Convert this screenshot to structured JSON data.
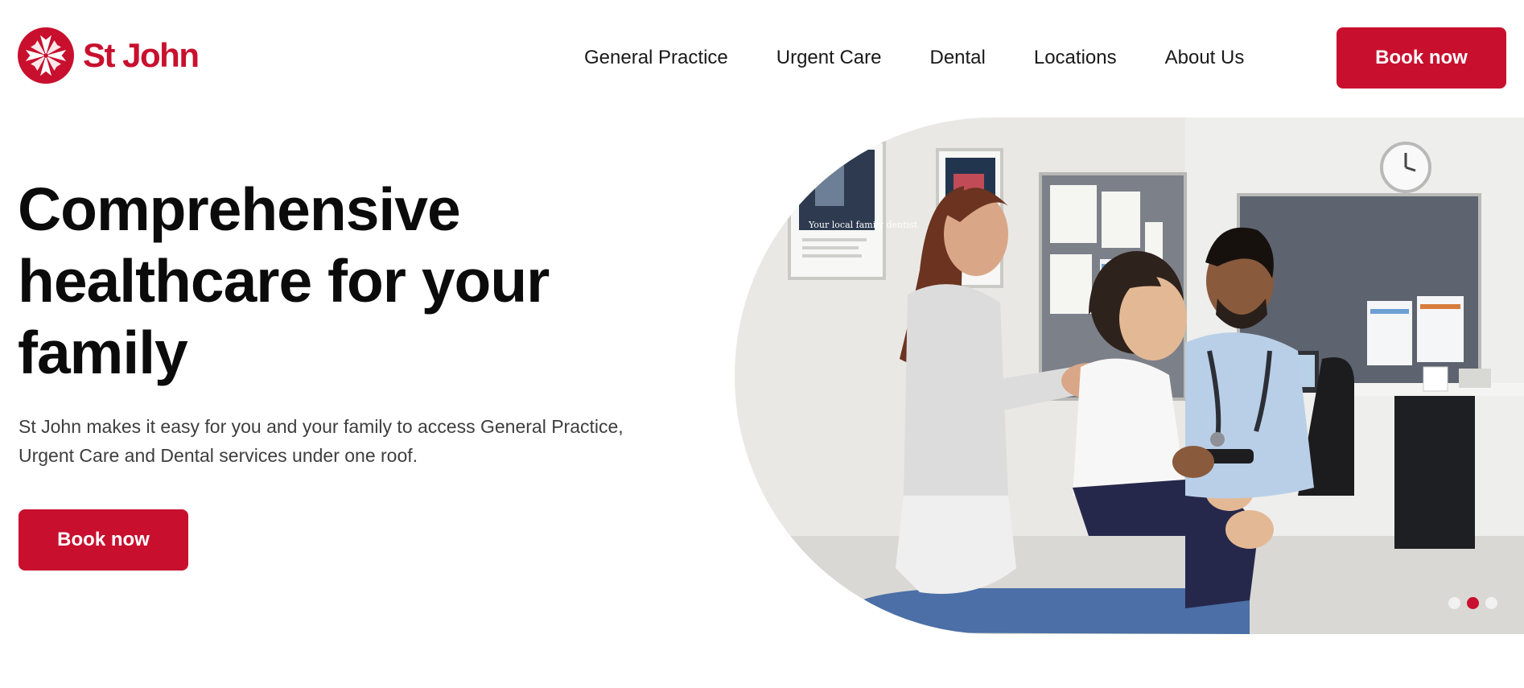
{
  "brand": {
    "name": "St John",
    "accent_color": "#c8102e",
    "logo_icon": "st-john-star-icon"
  },
  "nav": {
    "items": [
      {
        "label": "General Practice"
      },
      {
        "label": "Urgent Care"
      },
      {
        "label": "Dental"
      },
      {
        "label": "Locations"
      },
      {
        "label": "About Us"
      }
    ]
  },
  "header": {
    "cta_label": "Book now"
  },
  "hero": {
    "title": "Comprehensive healthcare for your family",
    "subtitle": "St John makes it easy for you and your family to access General Practice, Urgent Care and Dental services under one roof.",
    "cta_label": "Book now",
    "poster_caption": "Your local family dentist"
  },
  "carousel": {
    "slide_count": 3,
    "active_index": 1
  }
}
